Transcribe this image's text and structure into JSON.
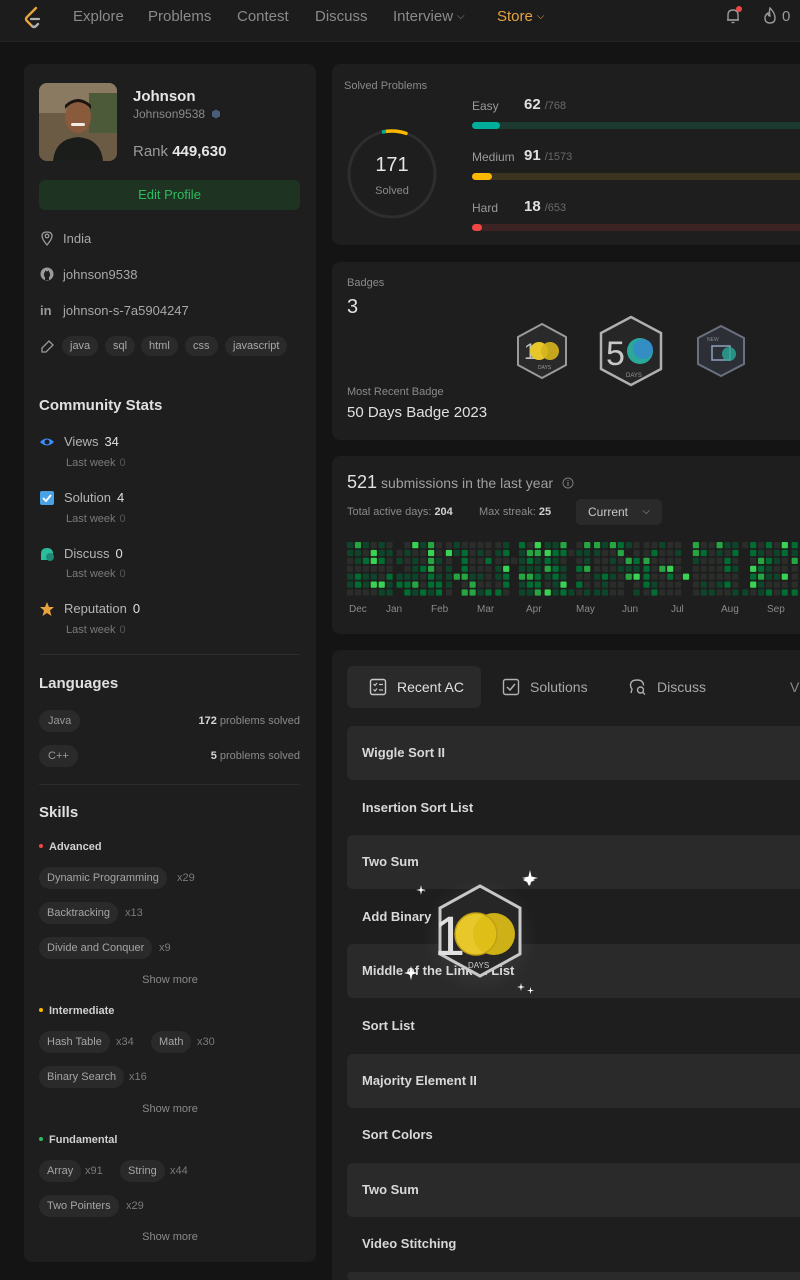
{
  "nav": {
    "items": [
      "Explore",
      "Problems",
      "Contest",
      "Discuss",
      "Interview"
    ],
    "store": "Store",
    "streak": "0"
  },
  "profile": {
    "name": "Johnson",
    "username": "Johnson9538",
    "rank_label": "Rank",
    "rank_value": "449,630",
    "edit_label": "Edit Profile",
    "location": "India",
    "github": "johnson9538",
    "linkedin": "johnson-s-7a5904247",
    "tags": [
      "java",
      "sql",
      "html",
      "css",
      "javascript"
    ]
  },
  "community": {
    "title": "Community Stats",
    "last_week_label": "Last week",
    "stats": [
      {
        "label": "Views",
        "value": "34",
        "last_week": "0",
        "color": "#3d8eff",
        "icon": "eye-icon"
      },
      {
        "label": "Solution",
        "value": "4",
        "last_week": "0",
        "color": "#4aa2e6",
        "icon": "check-square-icon"
      },
      {
        "label": "Discuss",
        "value": "0",
        "last_week": "0",
        "color": "#2cbb9c",
        "icon": "chat-icon"
      },
      {
        "label": "Reputation",
        "value": "0",
        "last_week": "0",
        "color": "#e7a33e",
        "icon": "star-icon"
      }
    ]
  },
  "languages": {
    "title": "Languages",
    "suffix": "problems solved",
    "items": [
      {
        "name": "Java",
        "count": "172"
      },
      {
        "name": "C++",
        "count": "5"
      }
    ]
  },
  "skills": {
    "title": "Skills",
    "show_more": "Show more",
    "levels": [
      {
        "name": "Advanced",
        "color": "#ef4743",
        "items": [
          {
            "name": "Dynamic Programming",
            "count": "x29"
          },
          {
            "name": "Backtracking",
            "count": "x13"
          },
          {
            "name": "Divide and Conquer",
            "count": "x9"
          }
        ]
      },
      {
        "name": "Intermediate",
        "color": "#ffb800",
        "items": [
          {
            "name": "Hash Table",
            "count": "x34"
          },
          {
            "name": "Math",
            "count": "x30"
          },
          {
            "name": "Binary Search",
            "count": "x16"
          }
        ]
      },
      {
        "name": "Fundamental",
        "color": "#2cbb5d",
        "items": [
          {
            "name": "Array",
            "count": "x91"
          },
          {
            "name": "String",
            "count": "x44"
          },
          {
            "name": "Two Pointers",
            "count": "x29"
          }
        ]
      }
    ]
  },
  "solved": {
    "title": "Solved Problems",
    "total": "171",
    "total_label": "Solved",
    "difficulties": [
      {
        "label": "Easy",
        "solved": "62",
        "total": "/768",
        "fill": 0.081,
        "color": "#00af9b",
        "track": "#1c3a30"
      },
      {
        "label": "Medium",
        "solved": "91",
        "total": "/1573",
        "fill": 0.058,
        "color": "#ffb800",
        "track": "#3d3420"
      },
      {
        "label": "Hard",
        "solved": "18",
        "total": "/653",
        "fill": 0.028,
        "color": "#ef4743",
        "track": "#3d2324"
      }
    ]
  },
  "badges": {
    "title": "Badges",
    "count": "3",
    "recent_label": "Most Recent Badge",
    "recent_name": "50 Days Badge 2023",
    "items": [
      "100-days-badge-icon",
      "50-days-badge-icon",
      "annual-badge-icon"
    ]
  },
  "submissions": {
    "count": "521",
    "label": "submissions in the last year",
    "active_label": "Total active days:",
    "active_value": "204",
    "streak_label": "Max streak:",
    "streak_value": "25",
    "period": "Current",
    "months": [
      "Dec",
      "Jan",
      "Feb",
      "Mar",
      "Apr",
      "May",
      "Jun",
      "Jul",
      "Aug",
      "Sep"
    ]
  },
  "tabs": [
    "Recent AC",
    "Solutions",
    "Discuss",
    "Vi"
  ],
  "recent_ac": [
    "Wiggle Sort II",
    "Insertion Sort List",
    "Two Sum",
    "Add Binary",
    "Middle of the Linked List",
    "Sort List",
    "Majority Element II",
    "Sort Colors",
    "Two Sum",
    "Video Stitching"
  ],
  "popup_badge": {
    "label": "DAYS"
  }
}
